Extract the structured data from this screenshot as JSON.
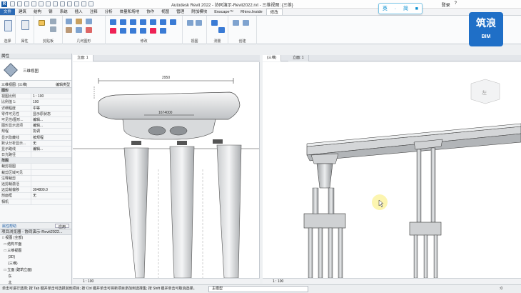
{
  "titlebar": {
    "logo": "R",
    "title": "Autodesk Revit 2022 - 协同演示-Revit2022.rvt - 三维视图: {三维}",
    "user": "登录",
    "help": "?"
  },
  "ime": {
    "lang": "英",
    "dot": "·",
    "punct": "简"
  },
  "menubar": {
    "tabs": [
      "文件",
      "建筑",
      "结构",
      "钢",
      "系统",
      "插入",
      "注释",
      "分析",
      "体量和场地",
      "协作",
      "视图",
      "管理",
      "附加模块",
      "Enscape™",
      "Rhino.Inside",
      "修改"
    ]
  },
  "ribbon": {
    "groups": [
      "选择",
      "属性",
      "剪贴板",
      "几何图形",
      "修改",
      "视图",
      "测量",
      "创建"
    ]
  },
  "brand": {
    "cn": "筑浪",
    "en": "BIM"
  },
  "properties": {
    "header": "属性",
    "type_name": "三维视图",
    "view_selector": "三维视图: {三维}",
    "edit_type": "编辑类型",
    "section": "图形",
    "rows": [
      {
        "k": "视图比例",
        "v": "1 : 100"
      },
      {
        "k": "比例值 1:",
        "v": "100"
      },
      {
        "k": "详细程度",
        "v": "中等"
      },
      {
        "k": "零件可见性",
        "v": "显示原状态"
      },
      {
        "k": "可见性/图形...",
        "v": "编辑..."
      },
      {
        "k": "图形显示选项",
        "v": "编辑..."
      },
      {
        "k": "规程",
        "v": "协调"
      },
      {
        "k": "显示隐藏线",
        "v": "按规程"
      },
      {
        "k": "默认分析显示...",
        "v": "无"
      },
      {
        "k": "显示路线",
        "v": "编辑..."
      },
      {
        "k": "日光路径",
        "v": ""
      }
    ],
    "section2": "范围",
    "rows2": [
      {
        "k": "裁剪视图",
        "v": ""
      },
      {
        "k": "裁剪区域可见",
        "v": ""
      },
      {
        "k": "注释裁剪",
        "v": ""
      },
      {
        "k": "远剪裁激活",
        "v": ""
      },
      {
        "k": "远剪裁偏移",
        "v": "304800.0"
      },
      {
        "k": "剖面框",
        "v": "无"
      },
      {
        "k": "相机",
        "v": ""
      }
    ],
    "help_link": "属性帮助",
    "apply": "应用"
  },
  "browser": {
    "header": "项目浏览器 - 协同演示-Revit2022...",
    "items": [
      "□ 视图 (全部)",
      "  □ 结构平面",
      "  □ 三维视图",
      "      {3D}",
      "      {三维}",
      "  □ 立面 (建筑立面)",
      "      东",
      "      北",
      "      南"
    ]
  },
  "views": {
    "left_tab": "立面: 1",
    "left_scale": "1 : 100",
    "right_tab1": "{三维}",
    "right_tab2": "立面: 1",
    "dim_top": "2950",
    "dim_mid": "1674000",
    "right_scale": "1 : 100"
  },
  "status": {
    "text": "单击可进行选择; 按 Tab 键并单击可选择其他项目; 按 Ctrl 键并单击可将新项目添加到选择集; 按 Shift 键并单击可取消选择。",
    "model": "主模型",
    "zero": ":0"
  }
}
